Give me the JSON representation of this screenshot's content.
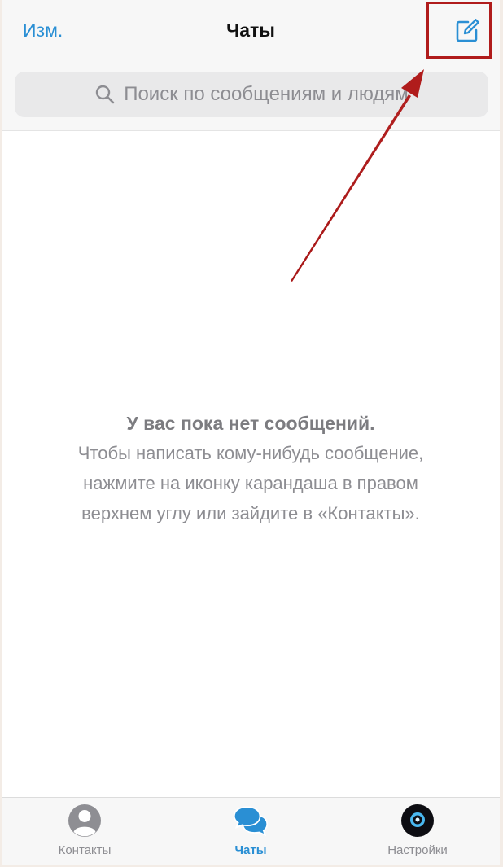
{
  "header": {
    "edit_label": "Изм.",
    "title": "Чаты"
  },
  "search": {
    "placeholder": "Поиск по сообщениям и людям"
  },
  "empty_state": {
    "title": "У вас пока нет сообщений.",
    "line1": "Чтобы написать кому-нибудь сообщение,",
    "line2": "нажмите на иконку карандаша в правом",
    "line3": "верхнем углу или зайдите в «Контакты»."
  },
  "tabbar": {
    "tabs": [
      {
        "label": "Контакты",
        "icon": "person-circle-icon",
        "active": false
      },
      {
        "label": "Чаты",
        "icon": "chat-bubbles-icon",
        "active": true
      },
      {
        "label": "Настройки",
        "icon": "avatar-icon",
        "active": false
      }
    ]
  },
  "icons": {
    "compose": "compose-icon",
    "search": "search-icon"
  },
  "colors": {
    "accent": "#2a8fd4",
    "annotation": "#b01c1c"
  }
}
